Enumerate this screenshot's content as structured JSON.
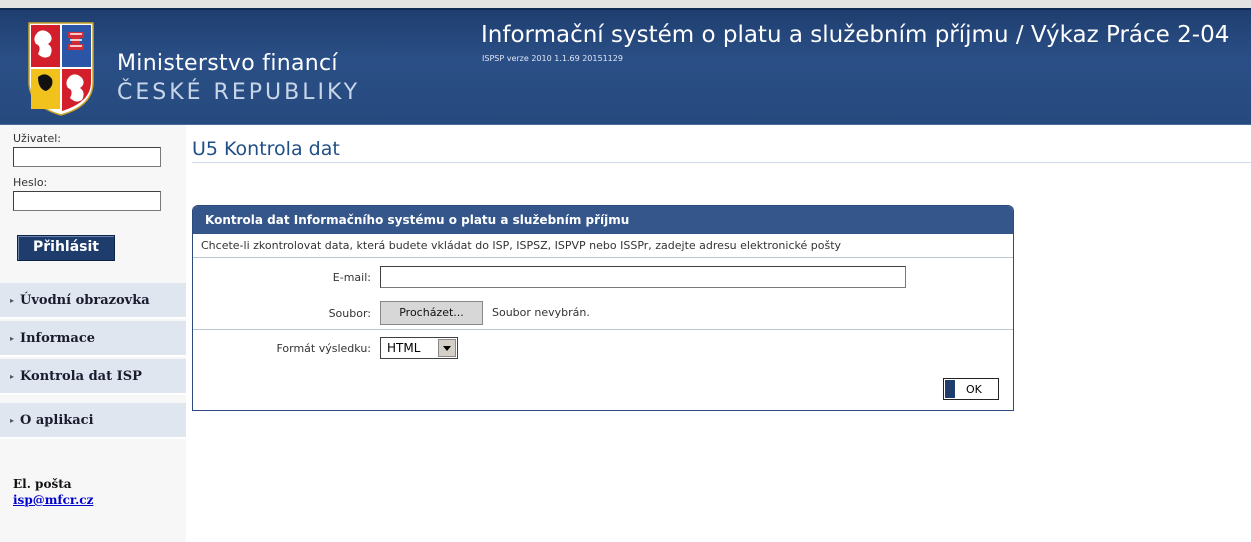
{
  "header": {
    "org_line1": "Ministerstvo financí",
    "org_line2": "ČESKÉ REPUBLIKY",
    "app_title": "Informační systém o platu a služebním příjmu / Výkaz Práce 2-04",
    "version": "ISPSP verze 2010 1.1.69 20151129"
  },
  "sidebar": {
    "user_label": "Uživatel:",
    "password_label": "Heslo:",
    "login_button": "Přihlásit",
    "nav": [
      {
        "label": "Úvodní obrazovka"
      },
      {
        "label": "Informace"
      },
      {
        "label": "Kontrola dat ISP"
      },
      {
        "label": "O aplikaci"
      }
    ],
    "mail_label": "El. pošta",
    "mail_link": "isp@mfcr.cz"
  },
  "main": {
    "page_title": "U5 Kontrola dat",
    "panel": {
      "title": "Kontrola dat Informačního systému o platu a služebním příjmu",
      "description": "Chcete-li zkontrolovat data, která budete vkládat do ISP, ISPSZ, ISPVP nebo ISSPr, zadejte adresu elektronické pošty",
      "email_label": "E-mail:",
      "email_value": "",
      "file_label": "Soubor:",
      "browse_button": "Procházet...",
      "file_status": "Soubor nevybrán.",
      "format_label": "Formát výsledku:",
      "format_value": "HTML",
      "ok_button": "OK"
    }
  },
  "colors": {
    "header_blue": "#264a7e",
    "nav_bg": "#dfe6f0",
    "title_blue": "#1f4f86",
    "link": "#0000cc"
  }
}
